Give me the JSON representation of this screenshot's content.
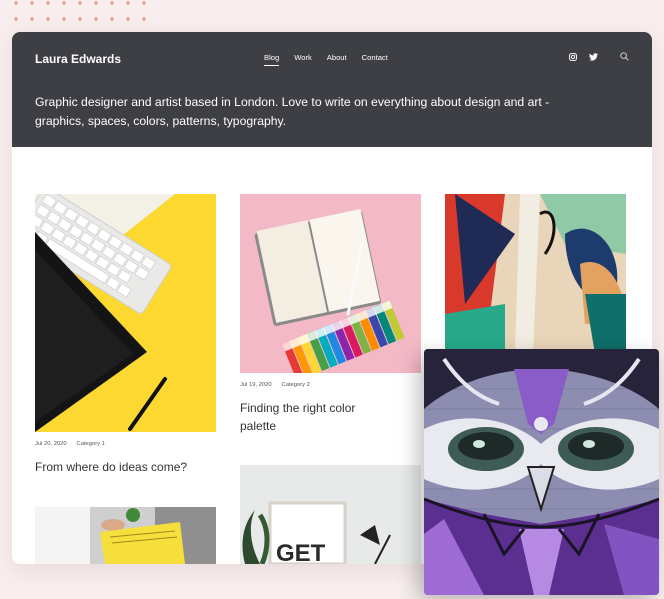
{
  "header": {
    "brand": "Laura Edwards",
    "nav": [
      "Blog",
      "Work",
      "About",
      "Contact"
    ],
    "intro": "Graphic designer and artist based in London. Love to write on everything about design and art - graphics, spaces, colors, patterns, typography."
  },
  "social": [
    "instagram-icon",
    "twitter-icon",
    "search-icon"
  ],
  "posts": [
    {
      "date": "Jul 20, 2020",
      "category": "Category 1",
      "title": "From where do ideas come?"
    },
    {
      "date": "Jul 19, 2020",
      "category": "Category 2",
      "title": "Finding the right color palette"
    },
    {
      "art_text": "GET"
    }
  ],
  "colors": {
    "header_bg": "#3d3f45",
    "page_bg": "#f8eeee",
    "yellow": "#fcd831",
    "pink": "#f4b9c7"
  }
}
